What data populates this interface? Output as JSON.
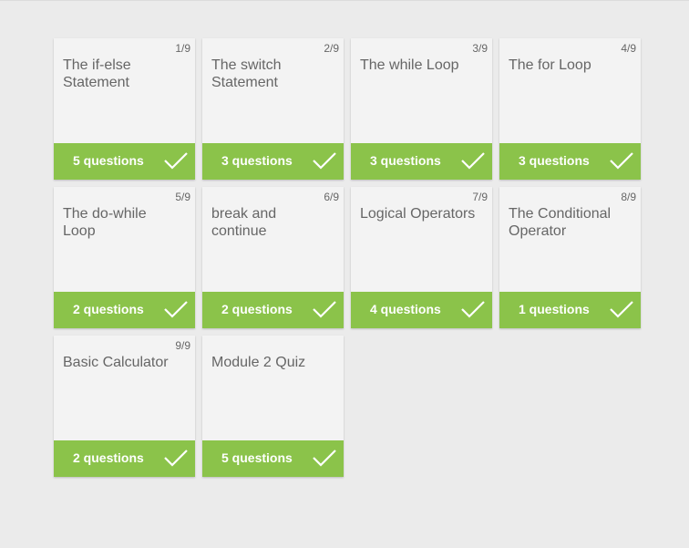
{
  "accent_color": "#8bc34a",
  "lessons": [
    {
      "index": "1/9",
      "title": "The if-else Statement",
      "questions": "5 questions",
      "completed": true,
      "icon": "check-icon"
    },
    {
      "index": "2/9",
      "title": "The switch Statement",
      "questions": "3 questions",
      "completed": true,
      "icon": "check-icon"
    },
    {
      "index": "3/9",
      "title": "The while Loop",
      "questions": "3 questions",
      "completed": true,
      "icon": "check-icon"
    },
    {
      "index": "4/9",
      "title": "The for Loop",
      "questions": "3 questions",
      "completed": true,
      "icon": "check-icon"
    },
    {
      "index": "5/9",
      "title": "The do-while Loop",
      "questions": "2 questions",
      "completed": true,
      "icon": "check-icon"
    },
    {
      "index": "6/9",
      "title": "break and continue",
      "questions": "2 questions",
      "completed": true,
      "icon": "check-icon"
    },
    {
      "index": "7/9",
      "title": "Logical Operators",
      "questions": "4 questions",
      "completed": true,
      "icon": "check-icon"
    },
    {
      "index": "8/9",
      "title": "The Conditional Operator",
      "questions": "1 questions",
      "completed": true,
      "icon": "check-icon"
    },
    {
      "index": "9/9",
      "title": "Basic Calculator",
      "questions": "2 questions",
      "completed": true,
      "icon": "check-icon"
    },
    {
      "index": "",
      "title": "Module 2 Quiz",
      "questions": "5 questions",
      "completed": true,
      "icon": "check-icon"
    }
  ]
}
